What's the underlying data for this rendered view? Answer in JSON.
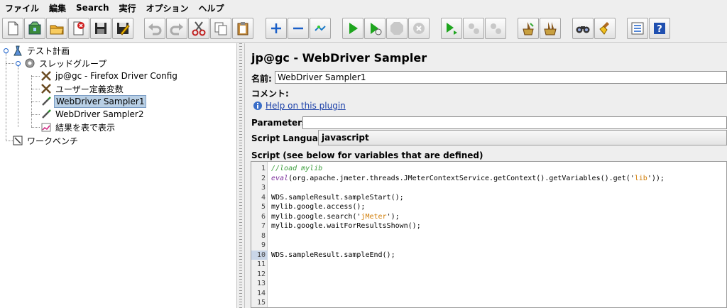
{
  "menu": [
    "ファイル",
    "編集",
    "Search",
    "実行",
    "オプション",
    "ヘルプ"
  ],
  "toolbar": [
    "new-icon",
    "templates-icon",
    "open-icon",
    "close-icon",
    "save-icon",
    "save-as-icon",
    "undo-icon",
    "redo-icon",
    "cut-icon",
    "copy-icon",
    "paste-icon",
    "expand-icon",
    "collapse-icon",
    "toggle-icon",
    "start-icon",
    "start-no-timers-icon",
    "stop-icon",
    "shutdown-icon",
    "remote-start-icon",
    "remote-stop-icon",
    "remote-shutdown-icon",
    "clear-icon",
    "clear-all-icon",
    "search-icon",
    "reset-search-icon",
    "function-helper-icon",
    "help-icon"
  ],
  "tree": {
    "test_plan": "テスト計画",
    "thread_group": "スレッドグループ",
    "config": "jp@gc - Firefox Driver Config",
    "user_vars": "ユーザー定義変数",
    "sampler1": "WebDriver Sampler1",
    "sampler2": "WebDriver Sampler2",
    "results": "結果を表で表示",
    "workbench": "ワークベンチ"
  },
  "panel": {
    "title": "jp@gc - WebDriver Sampler",
    "name_label": "名前:",
    "name_value": "WebDriver Sampler1",
    "comment_label": "コメント:",
    "comment_value": "",
    "help_link": "Help on this plugin",
    "params_label": "Parameters:",
    "params_value": "",
    "lang_label": "Script Language:",
    "lang_value": "javascript",
    "script_label": "Script (see below for variables that are defined)"
  },
  "editor": {
    "current_line": 10,
    "lines": [
      "//load mylib",
      "eval(org.apache.jmeter.threads.JMeterContextService.getContext().getVariables().get('lib'));",
      "",
      "WDS.sampleResult.sampleStart();",
      "mylib.google.access();",
      "mylib.google.search('jMeter');",
      "mylib.google.waitForResultsShown();",
      "",
      "",
      "WDS.sampleResult.sampleEnd();",
      "",
      "",
      "",
      "",
      ""
    ],
    "line_numbers": [
      "1",
      "2",
      "3",
      "4",
      "5",
      "6",
      "7",
      "8",
      "9",
      "10",
      "11",
      "12",
      "13",
      "14",
      "15"
    ]
  },
  "colors": {
    "selection": "#b8cfe5",
    "link": "#1a3fa8",
    "comment": "#3f9f3f",
    "string": "#d07a00",
    "keyword": "#7a2e9a"
  }
}
